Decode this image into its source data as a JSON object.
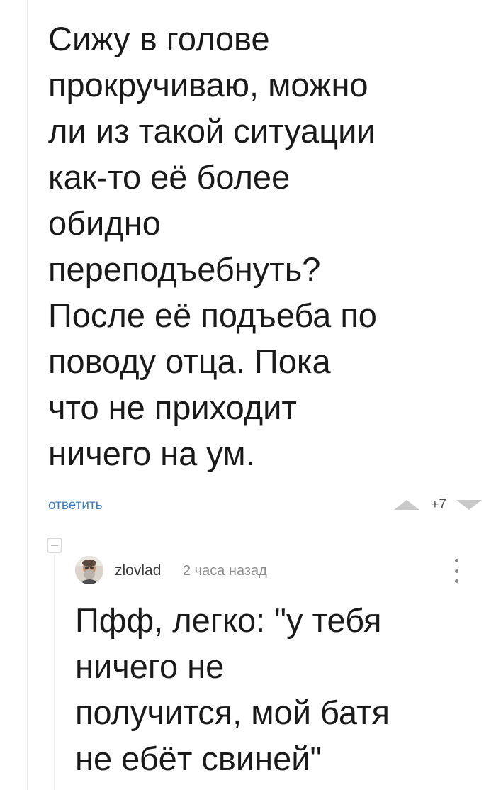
{
  "comment": {
    "text": "Сижу в голове\nпрокручиваю, можно\nли из такой ситуации\nкак-то её более\nобидно\nпереподъебнуть?\nПосле её подъеба по\nповоду отца. Пока\nчто не приходит\nничего на ум.",
    "reply_label": "ответить",
    "votes": "+7"
  },
  "reply": {
    "username": "zlovlad",
    "timestamp": "2 часа назад",
    "text": "Пфф, легко: \"у тебя\nничего не\nполучится, мой батя\nне ебёт свиней\""
  },
  "icons": {
    "vote_up": "triangle-up-icon",
    "vote_down": "triangle-down-icon",
    "collapse": "minus-square-icon",
    "more": "vertical-dots-icon"
  },
  "colors": {
    "link": "#3a7fc4",
    "text": "#1a1a1a",
    "muted": "#8e8e8e",
    "vote_arrow": "#c9c9c9"
  }
}
